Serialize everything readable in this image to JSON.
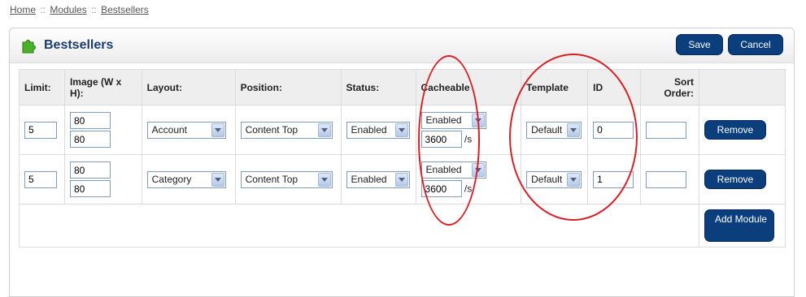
{
  "breadcrumb": {
    "home": "Home",
    "sep": "::",
    "modules": "Modules",
    "current": "Bestsellers"
  },
  "panel": {
    "title": "Bestsellers",
    "save_label": "Save",
    "cancel_label": "Cancel"
  },
  "columns": {
    "limit": "Limit:",
    "image": "Image (W x H):",
    "layout": "Layout:",
    "position": "Position:",
    "status": "Status:",
    "cacheable": "Cacheable",
    "template": "Template",
    "id": "ID",
    "sort_order": "Sort Order:"
  },
  "rows": [
    {
      "limit": "5",
      "img_w": "80",
      "img_h": "80",
      "layout": "Account",
      "position": "Content Top",
      "status": "Enabled",
      "cacheable": "Enabled",
      "cache_time": "3600",
      "cache_unit": "/s",
      "template": "Default",
      "id": "0",
      "sort_order": "",
      "remove_label": "Remove"
    },
    {
      "limit": "5",
      "img_w": "80",
      "img_h": "80",
      "layout": "Category",
      "position": "Content Top",
      "status": "Enabled",
      "cacheable": "Enabled",
      "cache_time": "3600",
      "cache_unit": "/s",
      "template": "Default",
      "id": "1",
      "sort_order": "",
      "remove_label": "Remove"
    }
  ],
  "add_module_label": "Add Module",
  "colors": {
    "button": "#0a3e7d",
    "title": "#1b3d6e",
    "annotation": "#d62027",
    "header_bg": "#eeeeee"
  },
  "icons": {
    "panel_icon": "puzzle-piece-icon"
  }
}
